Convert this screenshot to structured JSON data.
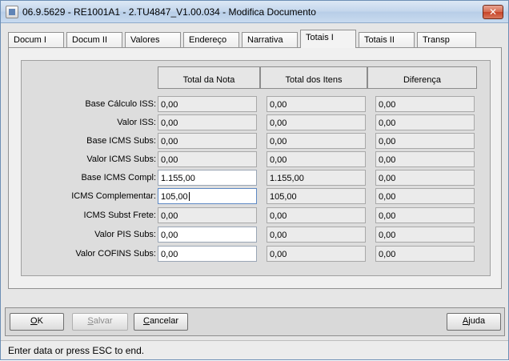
{
  "window": {
    "title": "06.9.5629 - RE1001A1 - 2.TU4847_V1.00.034 - Modifica Documento",
    "close_glyph": "✕"
  },
  "tabs": [
    "Docum I",
    "Docum II",
    "Valores",
    "Endereço",
    "Narrativa",
    "Totais I",
    "Totais II",
    "Transp"
  ],
  "active_tab": "Totais I",
  "columns": [
    "Total da Nota",
    "Total dos Itens",
    "Diferença"
  ],
  "rows": [
    {
      "label": "Base Cálculo ISS:",
      "nota": "0,00",
      "itens": "0,00",
      "dif": "0,00",
      "editable": false
    },
    {
      "label": "Valor ISS:",
      "nota": "0,00",
      "itens": "0,00",
      "dif": "0,00",
      "editable": false
    },
    {
      "label": "Base ICMS Subs:",
      "nota": "0,00",
      "itens": "0,00",
      "dif": "0,00",
      "editable": false
    },
    {
      "label": "Valor ICMS Subs:",
      "nota": "0,00",
      "itens": "0,00",
      "dif": "0,00",
      "editable": false
    },
    {
      "label": "Base ICMS Compl:",
      "nota": "1.155,00",
      "itens": "1.155,00",
      "dif": "0,00",
      "editable": true
    },
    {
      "label": "ICMS Complementar:",
      "nota": "105,00",
      "itens": "105,00",
      "dif": "0,00",
      "editable": true,
      "focused": true
    },
    {
      "label": "ICMS Subst Frete:",
      "nota": "0,00",
      "itens": "0,00",
      "dif": "0,00",
      "editable": false
    },
    {
      "label": "Valor PIS Subs:",
      "nota": "0,00",
      "itens": "0,00",
      "dif": "0,00",
      "editable": true
    },
    {
      "label": "Valor COFINS Subs:",
      "nota": "0,00",
      "itens": "0,00",
      "dif": "0,00",
      "editable": true
    }
  ],
  "buttons": {
    "ok": {
      "label": "OK",
      "mnemonic": "O",
      "rest": "K"
    },
    "salvar": {
      "label": "Salvar",
      "mnemonic": "S",
      "rest": "alvar"
    },
    "cancelar": {
      "label": "Cancelar",
      "mnemonic": "C",
      "rest": "ancelar"
    },
    "ajuda": {
      "label": "Ajuda",
      "mnemonic": "A",
      "rest": "juda"
    }
  },
  "status": "Enter data or press ESC to end."
}
